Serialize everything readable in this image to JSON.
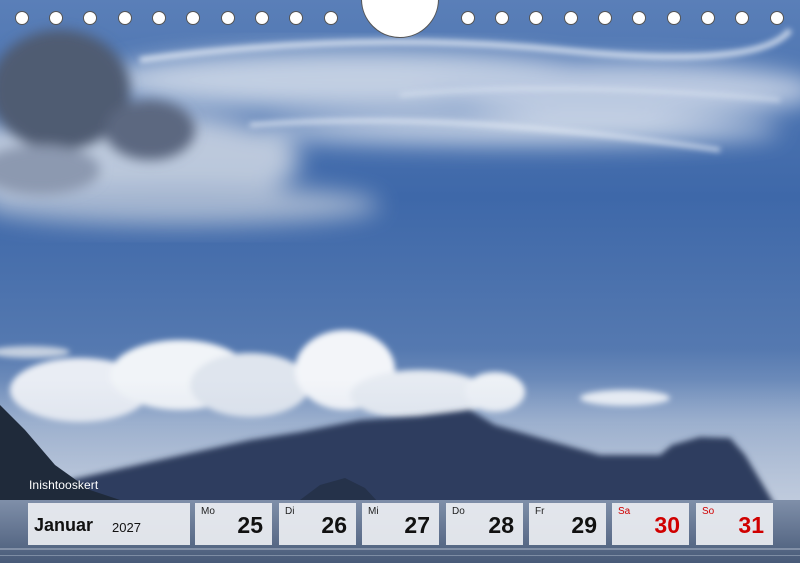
{
  "image": {
    "caption": "Inishtooskert",
    "description_icon": "photo-landscape"
  },
  "calendar": {
    "month": "Januar",
    "year": "2027",
    "days": [
      {
        "name": "Mo",
        "num": "25",
        "weekend": false
      },
      {
        "name": "Di",
        "num": "26",
        "weekend": false
      },
      {
        "name": "Mi",
        "num": "27",
        "weekend": false
      },
      {
        "name": "Do",
        "num": "28",
        "weekend": false
      },
      {
        "name": "Fr",
        "num": "29",
        "weekend": false
      },
      {
        "name": "Sa",
        "num": "30",
        "weekend": true
      },
      {
        "name": "So",
        "num": "31",
        "weekend": true
      }
    ]
  },
  "colors": {
    "weekend": "#d00000",
    "sky": "#3f6aa8",
    "cell_bg": "#eceef2"
  }
}
